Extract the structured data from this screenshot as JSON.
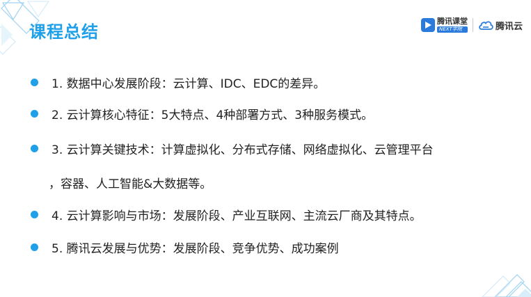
{
  "slide": {
    "title": "课程总结",
    "logos": {
      "ketang_main": "腾讯课堂",
      "ketang_sub": "NEXT学院",
      "cloud": "腾讯云"
    },
    "bullets": [
      {
        "text": "1. 数据中心发展阶段：云计算、IDC、EDC的差异。"
      },
      {
        "text": "2. 云计算核心特征：5大特点、4种部署方式、3种服务模式。"
      },
      {
        "text": "3. 云计算关键技术：计算虚拟化、分布式存储、网络虚拟化、云管理平台",
        "continuation": "，容器、人工智能&大数据等。"
      },
      {
        "text": "4. 云计算影响与市场：发展阶段、产业互联网、主流云厂商及其特点。"
      },
      {
        "text": "5. 腾讯云发展与优势：发展阶段、竞争优势、成功案例"
      }
    ]
  },
  "colors": {
    "accent": "#1fa0e8",
    "text": "#222222",
    "logo_blue": "#2a7bdc"
  },
  "icons": {
    "ketang_logo": "play-triangle-icon",
    "cloud_logo": "cloud-icon"
  }
}
